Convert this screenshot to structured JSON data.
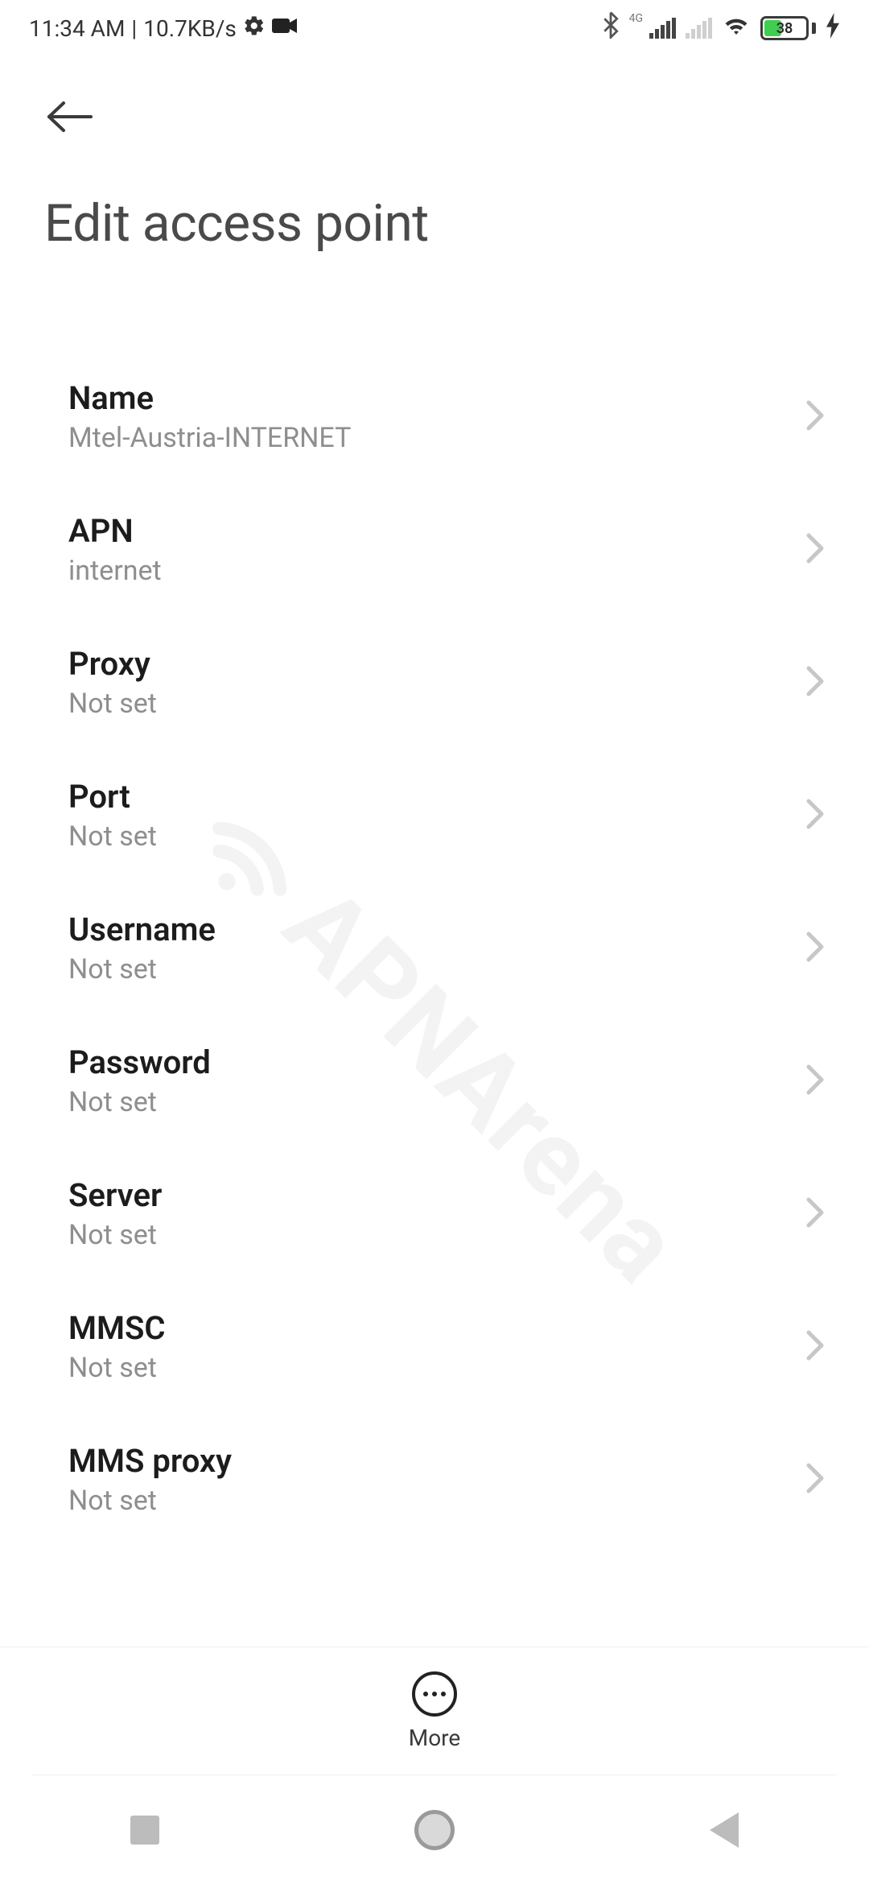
{
  "status": {
    "time": "11:34 AM",
    "separator": "|",
    "net_speed": "10.7KB/s",
    "signal_label": "4G",
    "battery_pct": "38"
  },
  "header": {
    "title": "Edit access point"
  },
  "settings": [
    {
      "label": "Name",
      "value": "Mtel-Austria-INTERNET"
    },
    {
      "label": "APN",
      "value": "internet"
    },
    {
      "label": "Proxy",
      "value": "Not set"
    },
    {
      "label": "Port",
      "value": "Not set"
    },
    {
      "label": "Username",
      "value": "Not set"
    },
    {
      "label": "Password",
      "value": "Not set"
    },
    {
      "label": "Server",
      "value": "Not set"
    },
    {
      "label": "MMSC",
      "value": "Not set"
    },
    {
      "label": "MMS proxy",
      "value": "Not set"
    }
  ],
  "options": {
    "more_label": "More"
  },
  "watermark": "APNArena"
}
